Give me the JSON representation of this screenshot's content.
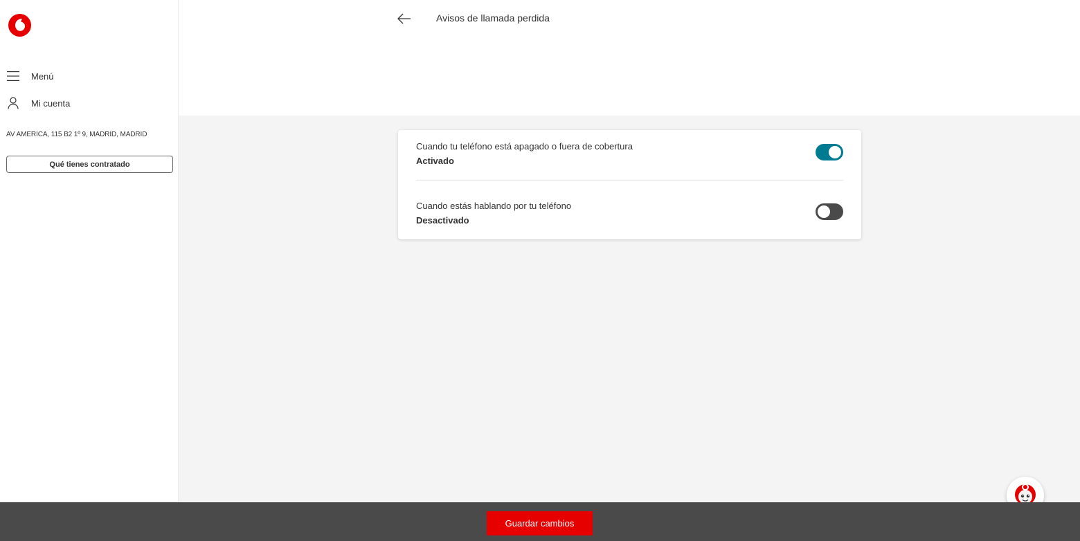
{
  "sidebar": {
    "menu_label": "Menú",
    "account_label": "Mi cuenta",
    "address": "AV AMERICA, 115 B2 1º 9, MADRID, MADRID",
    "contract_button": "Qué tienes contratado"
  },
  "header": {
    "title": "Avisos de llamada perdida"
  },
  "settings": [
    {
      "title": "Cuando tu teléfono está apagado o fuera de cobertura",
      "status": "Activado",
      "enabled": true
    },
    {
      "title": "Cuando estás hablando por tu teléfono",
      "status": "Desactivado",
      "enabled": false
    }
  ],
  "footer": {
    "save_label": "Guardar cambios"
  },
  "colors": {
    "brand_red": "#e60000",
    "toggle_on": "#007c92",
    "toggle_off": "#4a4a4a",
    "footer_bg": "#4a4a4a",
    "main_bg": "#f4f4f4"
  },
  "icons": {
    "logo": "vodafone-logo-icon",
    "menu": "hamburger-icon",
    "account": "user-icon",
    "back": "arrow-left-icon",
    "chat": "chat-bot-icon"
  }
}
